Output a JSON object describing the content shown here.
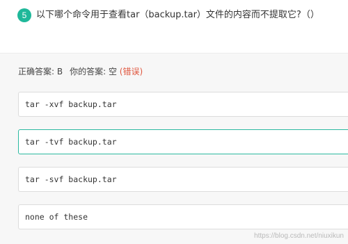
{
  "question": {
    "number": "5",
    "text": "以下哪个命令用于查看tar（backup.tar）文件的内容而不提取它?（）"
  },
  "result": {
    "correct_label": "正确答案: B",
    "yours_label": "你的答案: 空",
    "status": "(错误)"
  },
  "options": [
    {
      "text": "tar -xvf backup.tar"
    },
    {
      "text": "tar -tvf backup.tar"
    },
    {
      "text": "tar -svf backup.tar"
    },
    {
      "text": "none of these"
    }
  ],
  "watermark": "https://blog.csdn.net/niuxikun",
  "colors": {
    "accent": "#1fb89a",
    "correct_border": "#2bb9a0",
    "error_text": "#e0573f"
  }
}
